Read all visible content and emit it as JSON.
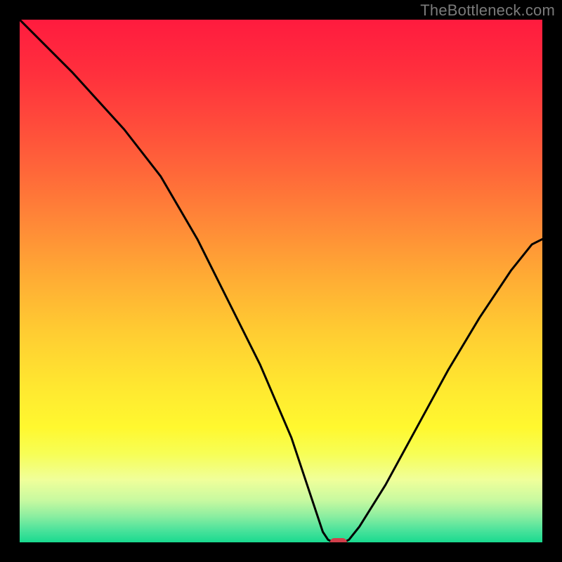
{
  "watermark": "TheBottleneck.com",
  "chart_data": {
    "type": "line",
    "title": "",
    "xlabel": "",
    "ylabel": "",
    "xlim": [
      0,
      100
    ],
    "ylim": [
      0,
      100
    ],
    "optimum_x": 61,
    "optimum_marker_color": "#d13f4b",
    "curve_color": "#000000",
    "curve": [
      {
        "x": 0,
        "y": 100
      },
      {
        "x": 10,
        "y": 90
      },
      {
        "x": 20,
        "y": 79
      },
      {
        "x": 27,
        "y": 70
      },
      {
        "x": 34,
        "y": 58
      },
      {
        "x": 40,
        "y": 46
      },
      {
        "x": 46,
        "y": 34
      },
      {
        "x": 52,
        "y": 20
      },
      {
        "x": 56,
        "y": 8
      },
      {
        "x": 58,
        "y": 2
      },
      {
        "x": 59,
        "y": 0.5
      },
      {
        "x": 60,
        "y": 0
      },
      {
        "x": 61,
        "y": 0
      },
      {
        "x": 62,
        "y": 0
      },
      {
        "x": 63,
        "y": 0.5
      },
      {
        "x": 65,
        "y": 3
      },
      {
        "x": 70,
        "y": 11
      },
      {
        "x": 76,
        "y": 22
      },
      {
        "x": 82,
        "y": 33
      },
      {
        "x": 88,
        "y": 43
      },
      {
        "x": 94,
        "y": 52
      },
      {
        "x": 98,
        "y": 57
      },
      {
        "x": 100,
        "y": 58
      }
    ],
    "gradient_stops": [
      {
        "offset": 0.0,
        "color": "#ff1b3e"
      },
      {
        "offset": 0.1,
        "color": "#ff2f3d"
      },
      {
        "offset": 0.2,
        "color": "#ff4b3b"
      },
      {
        "offset": 0.3,
        "color": "#ff6a39"
      },
      {
        "offset": 0.4,
        "color": "#ff8c37"
      },
      {
        "offset": 0.5,
        "color": "#ffae34"
      },
      {
        "offset": 0.6,
        "color": "#ffcd32"
      },
      {
        "offset": 0.7,
        "color": "#ffe730"
      },
      {
        "offset": 0.78,
        "color": "#fff82f"
      },
      {
        "offset": 0.83,
        "color": "#f7fe55"
      },
      {
        "offset": 0.88,
        "color": "#f0ff9a"
      },
      {
        "offset": 0.92,
        "color": "#c7f9a0"
      },
      {
        "offset": 0.95,
        "color": "#8beea0"
      },
      {
        "offset": 0.975,
        "color": "#4fe39c"
      },
      {
        "offset": 1.0,
        "color": "#19da8f"
      }
    ]
  }
}
